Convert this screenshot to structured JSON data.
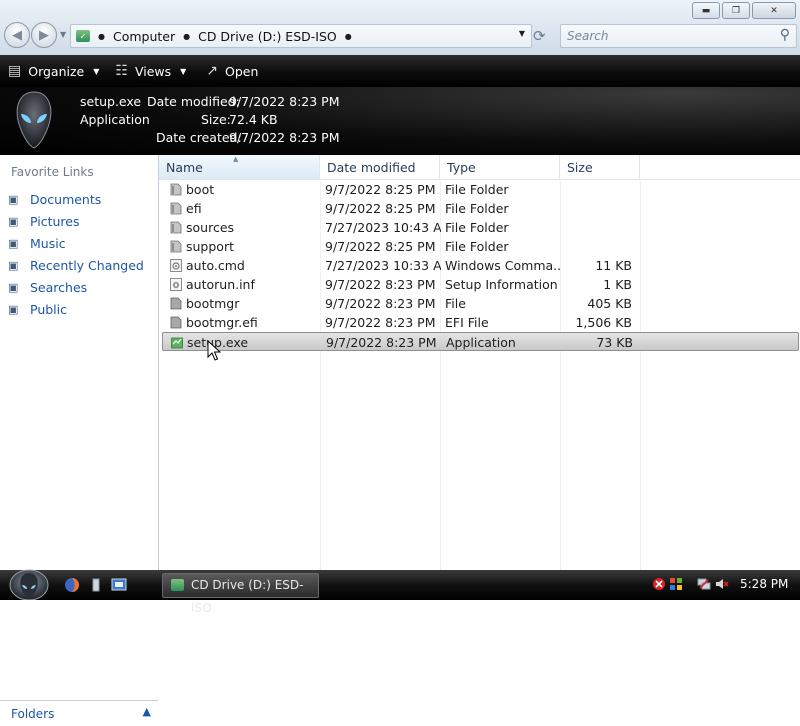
{
  "window": {
    "controls": {
      "minimize": "▬",
      "maximize": "❐",
      "close": "✕"
    },
    "nav": {
      "back_icon": "back-arrow-icon",
      "forward_icon": "forward-arrow-icon"
    },
    "address": {
      "crumbs": [
        "Computer",
        "CD Drive (D:) ESD-ISO"
      ]
    },
    "search": {
      "placeholder": "Search"
    }
  },
  "toolbar": {
    "organize": "Organize",
    "views": "Views",
    "open": "Open"
  },
  "details": {
    "name": "setup.exe",
    "type": "Application",
    "modified_label": "Date modified:",
    "modified_value": "9/7/2022 8:23 PM",
    "size_label": "Size:",
    "size_value": "72.4 KB",
    "created_label": "Date created:",
    "created_value": "9/7/2022 8:23 PM"
  },
  "sidebar": {
    "title": "Favorite Links",
    "links": [
      {
        "label": "Documents",
        "icon": "documents-icon"
      },
      {
        "label": "Pictures",
        "icon": "pictures-icon"
      },
      {
        "label": "Music",
        "icon": "music-icon"
      },
      {
        "label": "Recently Changed",
        "icon": "recently-changed-icon"
      },
      {
        "label": "Searches",
        "icon": "searches-icon"
      },
      {
        "label": "Public",
        "icon": "public-icon"
      }
    ],
    "folders_label": "Folders"
  },
  "columns": {
    "name": "Name",
    "modified": "Date modified",
    "type": "Type",
    "size": "Size"
  },
  "files": [
    {
      "name": "boot",
      "modified": "9/7/2022 8:25 PM",
      "type": "File Folder",
      "size": "",
      "icon": "folder"
    },
    {
      "name": "efi",
      "modified": "9/7/2022 8:25 PM",
      "type": "File Folder",
      "size": "",
      "icon": "folder"
    },
    {
      "name": "sources",
      "modified": "7/27/2023 10:43 AM",
      "type": "File Folder",
      "size": "",
      "icon": "folder"
    },
    {
      "name": "support",
      "modified": "9/7/2022 8:25 PM",
      "type": "File Folder",
      "size": "",
      "icon": "folder"
    },
    {
      "name": "auto.cmd",
      "modified": "7/27/2023 10:33 AM",
      "type": "Windows Comma...",
      "size": "11 KB",
      "icon": "cmd"
    },
    {
      "name": "autorun.inf",
      "modified": "9/7/2022 8:23 PM",
      "type": "Setup Information",
      "size": "1 KB",
      "icon": "inf"
    },
    {
      "name": "bootmgr",
      "modified": "9/7/2022 8:23 PM",
      "type": "File",
      "size": "405 KB",
      "icon": "file"
    },
    {
      "name": "bootmgr.efi",
      "modified": "9/7/2022 8:23 PM",
      "type": "EFI File",
      "size": "1,506 KB",
      "icon": "file"
    },
    {
      "name": "setup.exe",
      "modified": "9/7/2022 8:23 PM",
      "type": "Application",
      "size": "73 KB",
      "icon": "setup",
      "selected": true
    }
  ],
  "taskbar": {
    "window_button": "CD Drive (D:) ESD-ISO",
    "clock": "5:28 PM"
  }
}
